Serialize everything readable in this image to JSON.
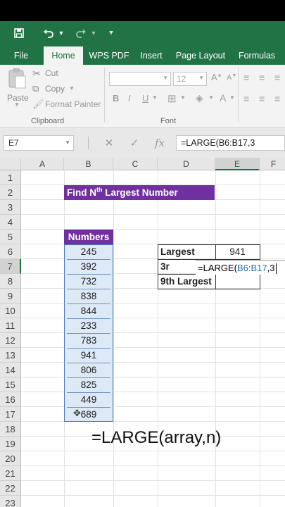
{
  "app": {
    "accent": "#217346",
    "header_color": "#7030a0",
    "range_fill": "#dde9f6"
  },
  "qat": {
    "save_icon": "save-icon",
    "undo_icon": "undo-icon",
    "redo_icon": "redo-icon",
    "customize_icon": "customize-icon"
  },
  "tabs": [
    "File",
    "Home",
    "WPS PDF",
    "Insert",
    "Page Layout",
    "Formulas"
  ],
  "active_tab": "Home",
  "ribbon": {
    "paste_label": "Paste",
    "cut_label": "Cut",
    "copy_label": "Copy",
    "format_painter_label": "Format Painter",
    "clipboard_group": "Clipboard",
    "font_group": "Font",
    "font_size": "12",
    "bold": "B",
    "italic": "I",
    "underline": "U"
  },
  "formula_bar": {
    "name_box": "E7",
    "cancel": "✕",
    "enter": "✓",
    "fx": "fx",
    "formula": "=LARGE(B6:B17,3"
  },
  "columns": [
    "A",
    "B",
    "C",
    "D",
    "E",
    "F"
  ],
  "rows": [
    "1",
    "2",
    "3",
    "4",
    "5",
    "6",
    "7",
    "8",
    "9",
    "10",
    "11",
    "12",
    "13",
    "14",
    "15",
    "16",
    "17",
    "18",
    "19",
    "20",
    "21",
    "22",
    "23"
  ],
  "sheet": {
    "title_main": "Find N",
    "title_sup": "th",
    "title_rest": " Largest Number",
    "numbers_header": "Numbers",
    "numbers": [
      "245",
      "392",
      "732",
      "838",
      "844",
      "233",
      "783",
      "941",
      "806",
      "825",
      "449",
      "689"
    ],
    "largest_label": "Largest",
    "largest_value": "941",
    "third_label": "3r",
    "editing_prefix": "=LARGE(",
    "editing_ref": "B6:B17",
    "editing_suffix": ",3",
    "ninth_label": "9th Largest"
  },
  "caption": "=LARGE(array,n)"
}
